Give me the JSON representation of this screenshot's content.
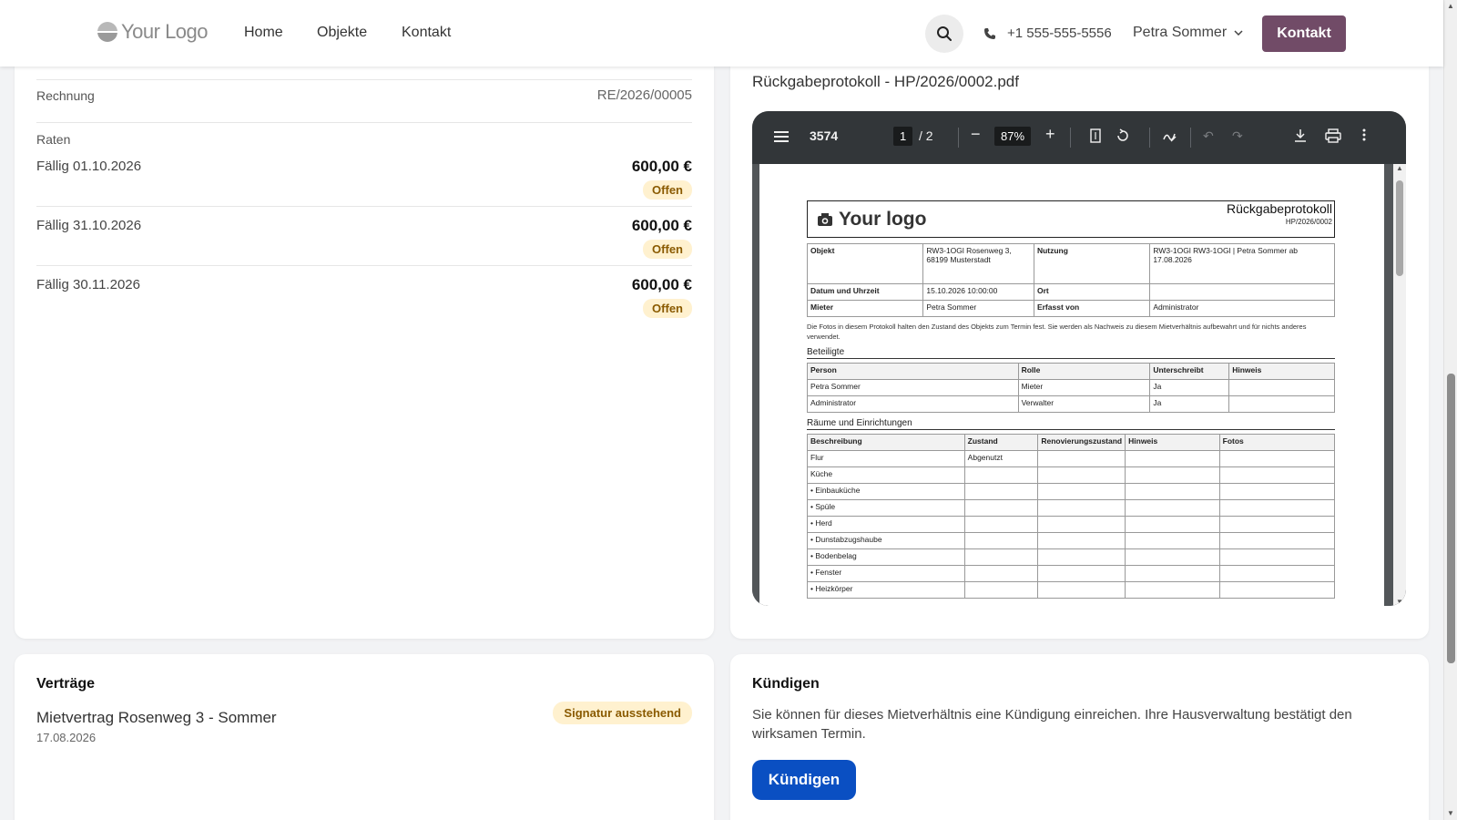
{
  "navbar": {
    "logo_text": "Your Logo",
    "links": [
      "Home",
      "Objekte",
      "Kontakt"
    ],
    "phone": "+1 555-555-5556",
    "user_name": "Petra Sommer",
    "cta_label": "Kontakt",
    "colors": {
      "cta": "#714b67"
    }
  },
  "billing": {
    "invoice_label": "Rechnung",
    "invoice_number": "RE/2026/00005",
    "rates_label": "Raten",
    "rates": [
      {
        "label": "Fällig 01.10.2026",
        "amount": "600,00 €",
        "status": "Offen"
      },
      {
        "label": "Fällig 31.10.2026",
        "amount": "600,00 €",
        "status": "Offen"
      },
      {
        "label": "Fällig 30.11.2026",
        "amount": "600,00 €",
        "status": "Offen"
      }
    ]
  },
  "pdf": {
    "filename": "Rückgabeprotokoll - HP/2026/0002.pdf",
    "toolbar": {
      "doc_id": "3574",
      "current_page": "1",
      "total_pages": "/ 2",
      "zoom": "87%"
    },
    "document": {
      "logo_text": "Your logo",
      "title": "Rückgabeprotokoll",
      "number": "HP/2026/0002",
      "info": {
        "objekt_label": "Objekt",
        "objekt_value": "RW3-1OGl Rosenweg 3, 68199 Musterstadt",
        "nutzung_label": "Nutzung",
        "nutzung_value": "RW3-1OGl RW3-1OGl | Petra Sommer ab 17.08.2026",
        "datum_label": "Datum und Uhrzeit",
        "datum_value": "15.10.2026 10:00:00",
        "ort_label": "Ort",
        "ort_value": "",
        "mieter_label": "Mieter",
        "mieter_value": "Petra Sommer",
        "erfasst_label": "Erfasst von",
        "erfasst_value": "Administrator"
      },
      "note": "Die Fotos in diesem Protokoll halten den Zustand des Objekts zum Termin fest. Sie werden als Nachweis zu diesem Mietverhältnis aufbewahrt und für nichts anderes verwendet.",
      "participants_title": "Beteiligte",
      "participants_headers": [
        "Person",
        "Rolle",
        "Unterschreibt",
        "Hinweis"
      ],
      "participants": [
        [
          "Petra Sommer",
          "Mieter",
          "Ja",
          ""
        ],
        [
          "Administrator",
          "Verwalter",
          "Ja",
          ""
        ]
      ],
      "rooms_title": "Räume und Einrichtungen",
      "rooms_headers": [
        "Beschreibung",
        "Zustand",
        "Renovierungszustand",
        "Hinweis",
        "Fotos"
      ],
      "rooms": [
        [
          "Flur",
          "Abgenutzt",
          "",
          "",
          ""
        ],
        [
          "Küche",
          "",
          "",
          "",
          ""
        ],
        [
          "• Einbauküche",
          "",
          "",
          "",
          ""
        ],
        [
          "• Spüle",
          "",
          "",
          "",
          ""
        ],
        [
          "• Herd",
          "",
          "",
          "",
          ""
        ],
        [
          "• Dunstabzugshaube",
          "",
          "",
          "",
          ""
        ],
        [
          "• Bodenbelag",
          "",
          "",
          "",
          ""
        ],
        [
          "• Fenster",
          "",
          "",
          "",
          ""
        ],
        [
          "• Heizkörper",
          "",
          "",
          "",
          ""
        ]
      ]
    }
  },
  "contracts": {
    "title": "Verträge",
    "items": [
      {
        "name": "Mietvertrag Rosenweg 3 - Sommer",
        "date": "17.08.2026",
        "status": "Signatur ausstehend"
      }
    ]
  },
  "termination": {
    "title": "Kündigen",
    "text": "Sie können für dieses Mietverhältnis eine Kündigung einreichen. Ihre Hausverwaltung bestätigt den wirksamen Termin.",
    "button_label": "Kündigen",
    "colors": {
      "button": "#0a4fc2"
    }
  }
}
